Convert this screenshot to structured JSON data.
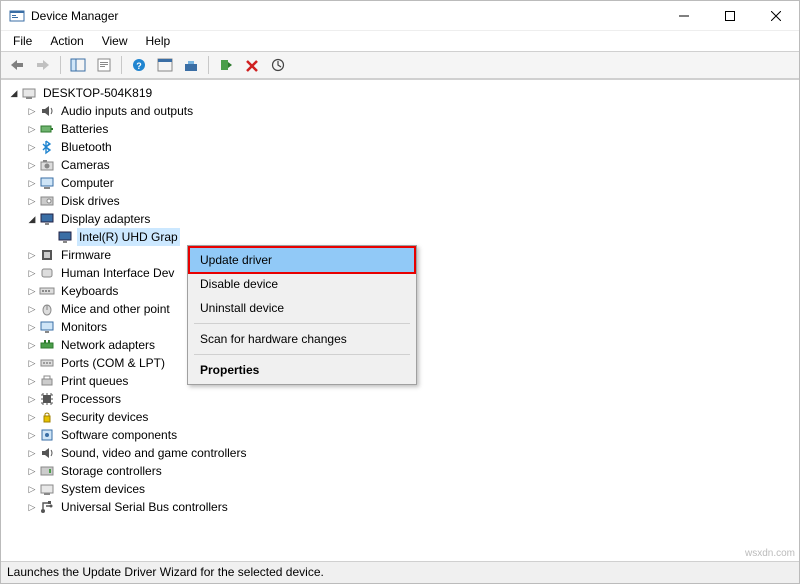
{
  "window": {
    "title": "Device Manager"
  },
  "window_controls": {
    "minimize": "—",
    "maximize": "▢",
    "close": "✕"
  },
  "menubar": {
    "file": "File",
    "action": "Action",
    "view": "View",
    "help": "Help"
  },
  "tree": {
    "root": "DESKTOP-504K819",
    "categories": [
      {
        "id": "audio",
        "label": "Audio inputs and outputs"
      },
      {
        "id": "batteries",
        "label": "Batteries"
      },
      {
        "id": "bluetooth",
        "label": "Bluetooth"
      },
      {
        "id": "cameras",
        "label": "Cameras"
      },
      {
        "id": "computer",
        "label": "Computer"
      },
      {
        "id": "disk",
        "label": "Disk drives"
      },
      {
        "id": "display",
        "label": "Display adapters",
        "expanded": true,
        "children": [
          {
            "id": "intel-uhd",
            "label": "Intel(R) UHD Grap",
            "selected": true
          }
        ]
      },
      {
        "id": "firmware",
        "label": "Firmware"
      },
      {
        "id": "hid",
        "label": "Human Interface Dev"
      },
      {
        "id": "keyboards",
        "label": "Keyboards"
      },
      {
        "id": "mice",
        "label": "Mice and other point"
      },
      {
        "id": "monitors",
        "label": "Monitors"
      },
      {
        "id": "network",
        "label": "Network adapters"
      },
      {
        "id": "ports",
        "label": "Ports (COM & LPT)"
      },
      {
        "id": "printq",
        "label": "Print queues"
      },
      {
        "id": "processors",
        "label": "Processors"
      },
      {
        "id": "security",
        "label": "Security devices"
      },
      {
        "id": "software",
        "label": "Software components"
      },
      {
        "id": "sound",
        "label": "Sound, video and game controllers"
      },
      {
        "id": "storage",
        "label": "Storage controllers"
      },
      {
        "id": "sysdev",
        "label": "System devices"
      },
      {
        "id": "usb",
        "label": "Universal Serial Bus controllers"
      }
    ]
  },
  "context_menu": {
    "update": "Update driver",
    "disable": "Disable device",
    "uninstall": "Uninstall device",
    "scan": "Scan for hardware changes",
    "properties": "Properties"
  },
  "statusbar": {
    "text": "Launches the Update Driver Wizard for the selected device."
  },
  "watermark": "wsxdn.com"
}
